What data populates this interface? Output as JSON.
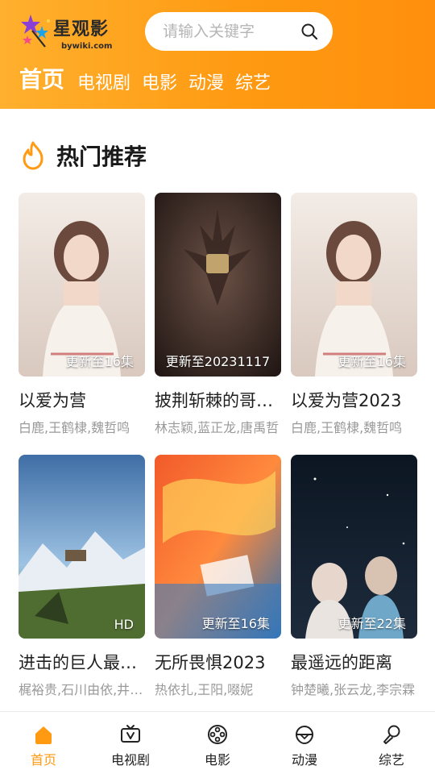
{
  "app": {
    "brand": "星观影",
    "domain": "bywiki.com"
  },
  "search": {
    "placeholder": "请输入关键字"
  },
  "nav": {
    "items": [
      {
        "label": "首页",
        "active": true
      },
      {
        "label": "电视剧",
        "active": false
      },
      {
        "label": "电影",
        "active": false
      },
      {
        "label": "动漫",
        "active": false
      },
      {
        "label": "综艺",
        "active": false
      }
    ]
  },
  "section": {
    "title": "热门推荐"
  },
  "cards": [
    {
      "title": "以爱为营",
      "cast": "白鹿,王鹤棣,魏哲鸣",
      "badge": "更新至16集"
    },
    {
      "title": "披荆斩棘的哥哥第三季",
      "cast": "林志颖,蓝正龙,唐禹哲",
      "badge": "更新至20231117"
    },
    {
      "title": "以爱为营2023",
      "cast": "白鹿,王鹤棣,魏哲鸣",
      "badge": "更新至16集"
    },
    {
      "title": "进击的巨人最终季",
      "cast": "梶裕贵,石川由依,井上麻里奈",
      "badge": "HD"
    },
    {
      "title": "无所畏惧2023",
      "cast": "热依扎,王阳,啜妮",
      "badge": "更新至16集"
    },
    {
      "title": "最遥远的距离",
      "cast": "钟楚曦,张云龙,李宗霖",
      "badge": "更新至22集"
    }
  ],
  "tabbar": {
    "items": [
      {
        "label": "首页",
        "icon": "home-icon",
        "active": true
      },
      {
        "label": "电视剧",
        "icon": "tv-icon",
        "active": false
      },
      {
        "label": "电影",
        "icon": "film-reel-icon",
        "active": false
      },
      {
        "label": "动漫",
        "icon": "anime-icon",
        "active": false
      },
      {
        "label": "综艺",
        "icon": "microphone-icon",
        "active": false
      }
    ]
  },
  "colors": {
    "accent": "#ff9a12",
    "header_start": "#ffb02e",
    "header_end": "#ff8f0d"
  }
}
